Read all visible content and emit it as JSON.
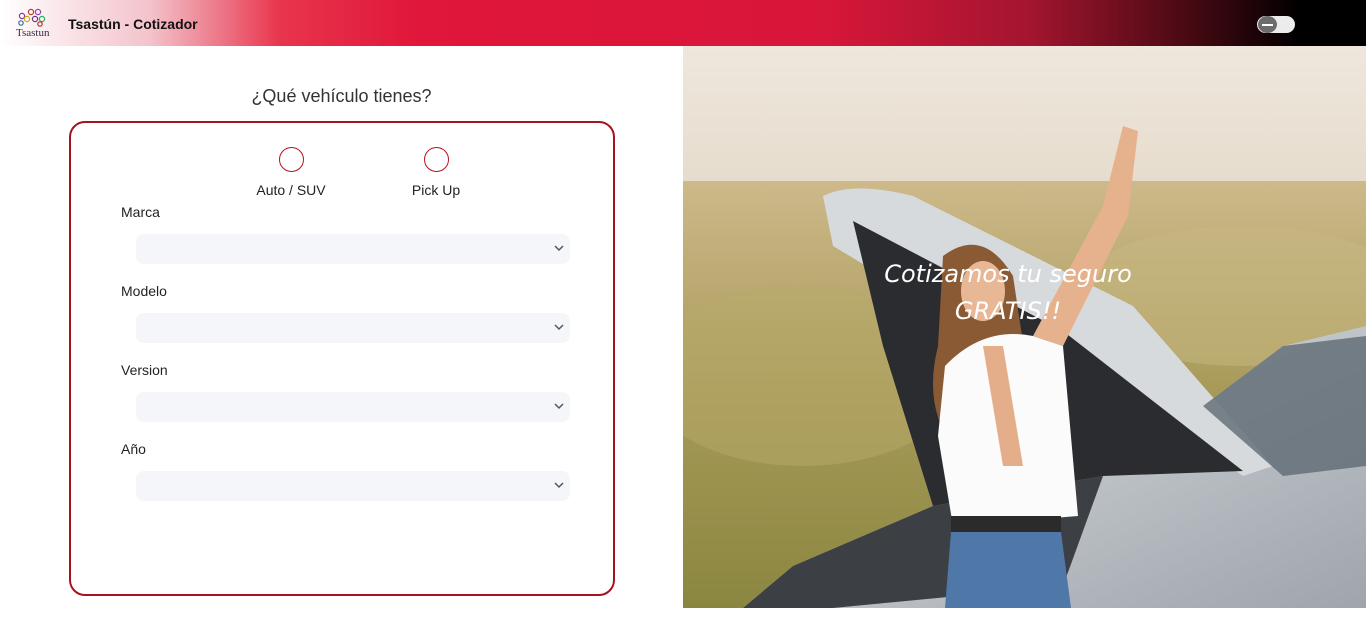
{
  "header": {
    "logo_text": "Tsastun",
    "title": "Tsastún - Cotizador",
    "theme_toggle": "off"
  },
  "form": {
    "question": "¿Qué vehículo tienes?",
    "vehicle_types": [
      {
        "label": "Auto / SUV",
        "selected": false
      },
      {
        "label": "Pick Up",
        "selected": false
      }
    ],
    "fields": [
      {
        "label": "Marca",
        "value": ""
      },
      {
        "label": "Modelo",
        "value": ""
      },
      {
        "label": "Version",
        "value": ""
      },
      {
        "label": "Año",
        "value": ""
      }
    ]
  },
  "hero": {
    "text": "Cotizamos tu seguro GRATIS!!"
  },
  "colors": {
    "brand_red": "#e0163a",
    "card_border": "#a6121f",
    "select_bg": "#f5f6fa"
  }
}
